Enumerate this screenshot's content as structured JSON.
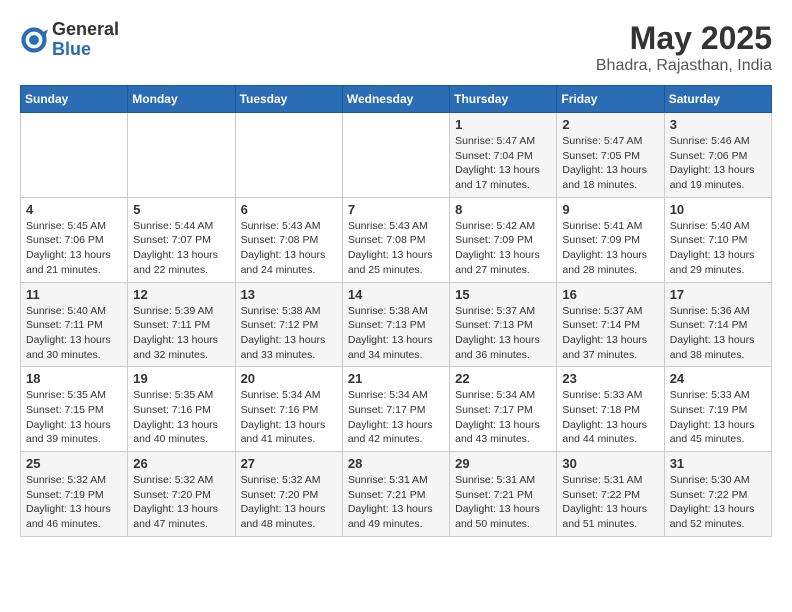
{
  "header": {
    "logo_general": "General",
    "logo_blue": "Blue",
    "month_year": "May 2025",
    "location": "Bhadra, Rajasthan, India"
  },
  "weekdays": [
    "Sunday",
    "Monday",
    "Tuesday",
    "Wednesday",
    "Thursday",
    "Friday",
    "Saturday"
  ],
  "weeks": [
    [
      {
        "day": "",
        "info": ""
      },
      {
        "day": "",
        "info": ""
      },
      {
        "day": "",
        "info": ""
      },
      {
        "day": "",
        "info": ""
      },
      {
        "day": "1",
        "info": "Sunrise: 5:47 AM\nSunset: 7:04 PM\nDaylight: 13 hours and 17 minutes."
      },
      {
        "day": "2",
        "info": "Sunrise: 5:47 AM\nSunset: 7:05 PM\nDaylight: 13 hours and 18 minutes."
      },
      {
        "day": "3",
        "info": "Sunrise: 5:46 AM\nSunset: 7:06 PM\nDaylight: 13 hours and 19 minutes."
      }
    ],
    [
      {
        "day": "4",
        "info": "Sunrise: 5:45 AM\nSunset: 7:06 PM\nDaylight: 13 hours and 21 minutes."
      },
      {
        "day": "5",
        "info": "Sunrise: 5:44 AM\nSunset: 7:07 PM\nDaylight: 13 hours and 22 minutes."
      },
      {
        "day": "6",
        "info": "Sunrise: 5:43 AM\nSunset: 7:08 PM\nDaylight: 13 hours and 24 minutes."
      },
      {
        "day": "7",
        "info": "Sunrise: 5:43 AM\nSunset: 7:08 PM\nDaylight: 13 hours and 25 minutes."
      },
      {
        "day": "8",
        "info": "Sunrise: 5:42 AM\nSunset: 7:09 PM\nDaylight: 13 hours and 27 minutes."
      },
      {
        "day": "9",
        "info": "Sunrise: 5:41 AM\nSunset: 7:09 PM\nDaylight: 13 hours and 28 minutes."
      },
      {
        "day": "10",
        "info": "Sunrise: 5:40 AM\nSunset: 7:10 PM\nDaylight: 13 hours and 29 minutes."
      }
    ],
    [
      {
        "day": "11",
        "info": "Sunrise: 5:40 AM\nSunset: 7:11 PM\nDaylight: 13 hours and 30 minutes."
      },
      {
        "day": "12",
        "info": "Sunrise: 5:39 AM\nSunset: 7:11 PM\nDaylight: 13 hours and 32 minutes."
      },
      {
        "day": "13",
        "info": "Sunrise: 5:38 AM\nSunset: 7:12 PM\nDaylight: 13 hours and 33 minutes."
      },
      {
        "day": "14",
        "info": "Sunrise: 5:38 AM\nSunset: 7:13 PM\nDaylight: 13 hours and 34 minutes."
      },
      {
        "day": "15",
        "info": "Sunrise: 5:37 AM\nSunset: 7:13 PM\nDaylight: 13 hours and 36 minutes."
      },
      {
        "day": "16",
        "info": "Sunrise: 5:37 AM\nSunset: 7:14 PM\nDaylight: 13 hours and 37 minutes."
      },
      {
        "day": "17",
        "info": "Sunrise: 5:36 AM\nSunset: 7:14 PM\nDaylight: 13 hours and 38 minutes."
      }
    ],
    [
      {
        "day": "18",
        "info": "Sunrise: 5:35 AM\nSunset: 7:15 PM\nDaylight: 13 hours and 39 minutes."
      },
      {
        "day": "19",
        "info": "Sunrise: 5:35 AM\nSunset: 7:16 PM\nDaylight: 13 hours and 40 minutes."
      },
      {
        "day": "20",
        "info": "Sunrise: 5:34 AM\nSunset: 7:16 PM\nDaylight: 13 hours and 41 minutes."
      },
      {
        "day": "21",
        "info": "Sunrise: 5:34 AM\nSunset: 7:17 PM\nDaylight: 13 hours and 42 minutes."
      },
      {
        "day": "22",
        "info": "Sunrise: 5:34 AM\nSunset: 7:17 PM\nDaylight: 13 hours and 43 minutes."
      },
      {
        "day": "23",
        "info": "Sunrise: 5:33 AM\nSunset: 7:18 PM\nDaylight: 13 hours and 44 minutes."
      },
      {
        "day": "24",
        "info": "Sunrise: 5:33 AM\nSunset: 7:19 PM\nDaylight: 13 hours and 45 minutes."
      }
    ],
    [
      {
        "day": "25",
        "info": "Sunrise: 5:32 AM\nSunset: 7:19 PM\nDaylight: 13 hours and 46 minutes."
      },
      {
        "day": "26",
        "info": "Sunrise: 5:32 AM\nSunset: 7:20 PM\nDaylight: 13 hours and 47 minutes."
      },
      {
        "day": "27",
        "info": "Sunrise: 5:32 AM\nSunset: 7:20 PM\nDaylight: 13 hours and 48 minutes."
      },
      {
        "day": "28",
        "info": "Sunrise: 5:31 AM\nSunset: 7:21 PM\nDaylight: 13 hours and 49 minutes."
      },
      {
        "day": "29",
        "info": "Sunrise: 5:31 AM\nSunset: 7:21 PM\nDaylight: 13 hours and 50 minutes."
      },
      {
        "day": "30",
        "info": "Sunrise: 5:31 AM\nSunset: 7:22 PM\nDaylight: 13 hours and 51 minutes."
      },
      {
        "day": "31",
        "info": "Sunrise: 5:30 AM\nSunset: 7:22 PM\nDaylight: 13 hours and 52 minutes."
      }
    ]
  ]
}
